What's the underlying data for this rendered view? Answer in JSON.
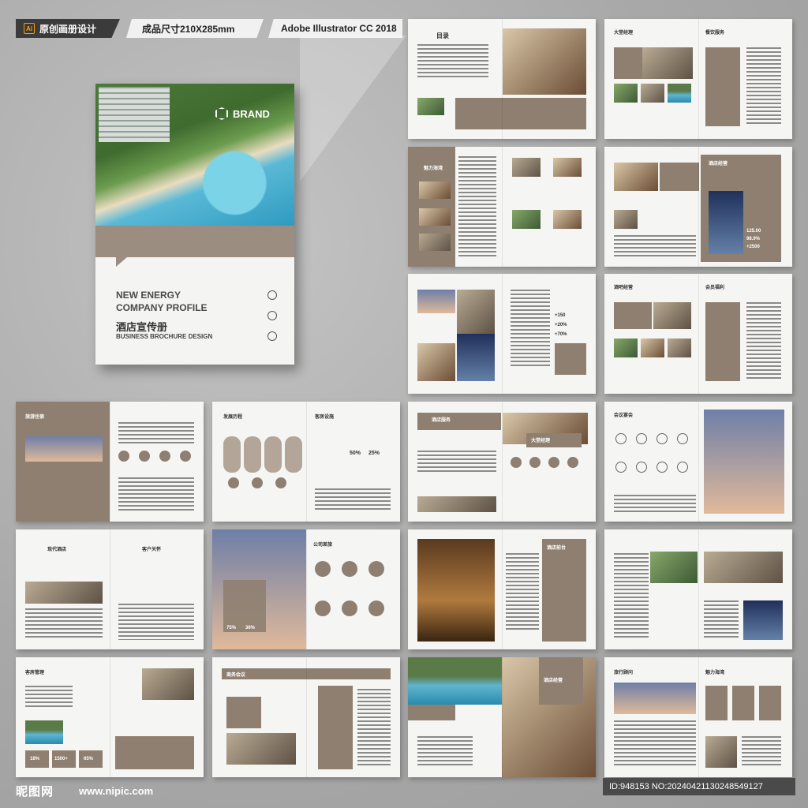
{
  "header": {
    "software_tag": "原创画册设计",
    "ai_badge": "Ai",
    "size_tag": "成品尺寸210X285mm",
    "version_tag": "Adobe Illustrator CC 2018"
  },
  "cover": {
    "brand": "BRAND",
    "title_line1": "NEW ENERGY",
    "title_line2": "COMPANY PROFILE",
    "title_cn": "酒店宣传册",
    "subtitle": "BUSINESS BROCHURE DESIGN"
  },
  "spreads": [
    {
      "left_title": "目录",
      "right_title": ""
    },
    {
      "left_title": "大堂经理",
      "right_title": "餐饮服务"
    },
    {
      "left_title": "魅力海湾",
      "right_title": ""
    },
    {
      "left_title": "",
      "right_title": "酒店经营"
    },
    {
      "left_title": "",
      "right_title": ""
    },
    {
      "left_title": "酒吧经营",
      "right_title": "会员福利"
    },
    {
      "left_title": "旅游住宿",
      "right_title": ""
    },
    {
      "left_title": "发展历程",
      "right_title": "客房设施"
    },
    {
      "left_title": "酒店服务",
      "right_title": "大堂经理"
    },
    {
      "left_title": "会议宴会",
      "right_title": ""
    },
    {
      "left_title": "现代酒店",
      "right_title": "客户关怀"
    },
    {
      "left_title": "",
      "right_title": "公司差旅"
    },
    {
      "left_title": "",
      "right_title": "酒店前台"
    },
    {
      "left_title": "",
      "right_title": ""
    },
    {
      "left_title": "客房管理",
      "right_title": ""
    },
    {
      "left_title": "商务会议",
      "right_title": ""
    },
    {
      "left_title": "",
      "right_title": "酒店经营"
    },
    {
      "left_title": "旅行顾问",
      "right_title": "魅力海湾"
    }
  ],
  "stats": {
    "s1": "50%",
    "s2": "25%",
    "s3": "75%",
    "s4": "36%",
    "s5": "18%",
    "s6": "1500+",
    "s7": "65%",
    "s8": "125.00",
    "s9": "98.9%",
    "s10": "+2500",
    "s11": "+150",
    "s12": "+20%",
    "s13": "+70%"
  },
  "footer": {
    "logo": "昵图网",
    "site": "www.nipic.com",
    "id_line": "ID:948153 NO:20240421130248549127"
  }
}
